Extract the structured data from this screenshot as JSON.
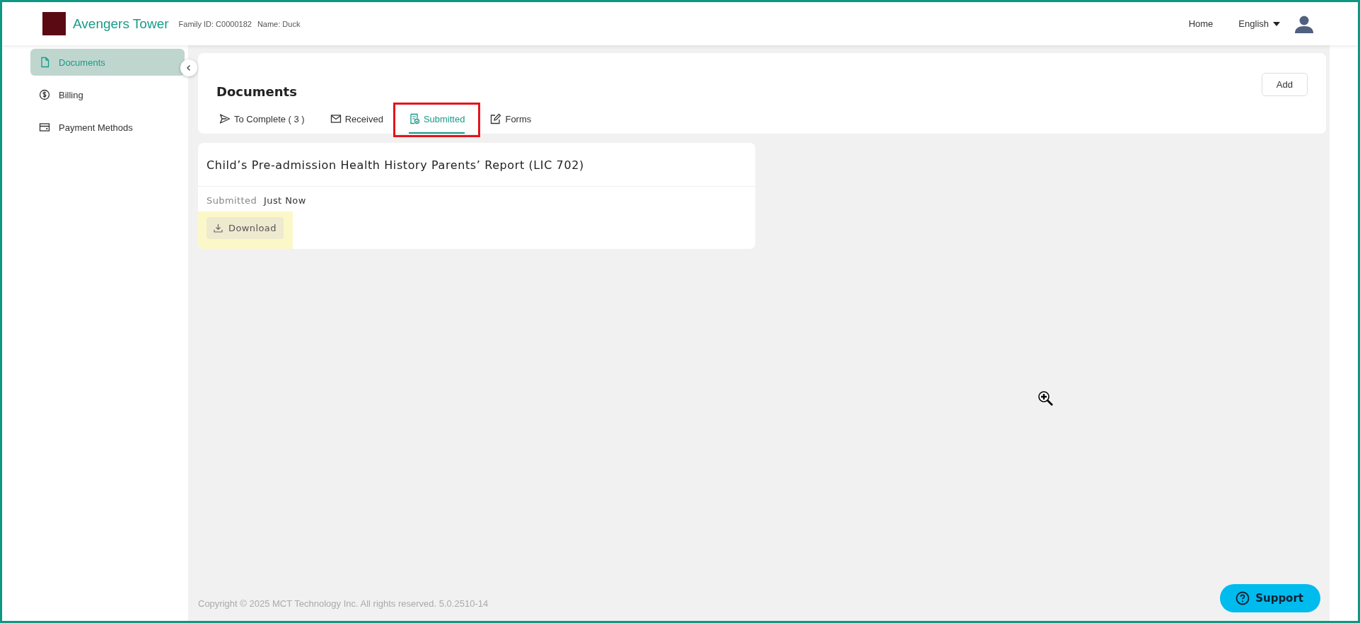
{
  "header": {
    "title": "Avengers Tower",
    "family_id": "Family ID: C0000182",
    "name": "Name: Duck",
    "nav": [
      {
        "label": "Home"
      }
    ],
    "language": "English"
  },
  "sidebar": {
    "items": [
      {
        "label": "Documents",
        "kind": "file",
        "selected": true
      },
      {
        "label": "Billing",
        "kind": "dollar",
        "selected": false
      },
      {
        "label": "Payment Methods",
        "kind": "card",
        "selected": false
      }
    ]
  },
  "page": {
    "title": "Documents",
    "add_button": "Add",
    "tabs": [
      {
        "label": "To Complete ( 3 )",
        "kind": "send",
        "selected": false,
        "outlined": false
      },
      {
        "label": "Received",
        "kind": "mail",
        "selected": false,
        "outlined": false
      },
      {
        "label": "Submitted",
        "kind": "doc",
        "selected": true,
        "outlined": true
      },
      {
        "label": "Forms",
        "kind": "edit",
        "selected": false,
        "outlined": false
      }
    ]
  },
  "documents": [
    {
      "title": "Child’s Pre-admission Health History Parents’ Report (LIC 702)",
      "status_label": "Submitted",
      "status_value": "Just Now",
      "action": "Download",
      "highlighted": true
    }
  ],
  "footer": {
    "copyright": "Copyright © 2025 MCT Technology Inc. All rights reserved. 5.0.2510-14"
  },
  "support_button": "Support"
}
